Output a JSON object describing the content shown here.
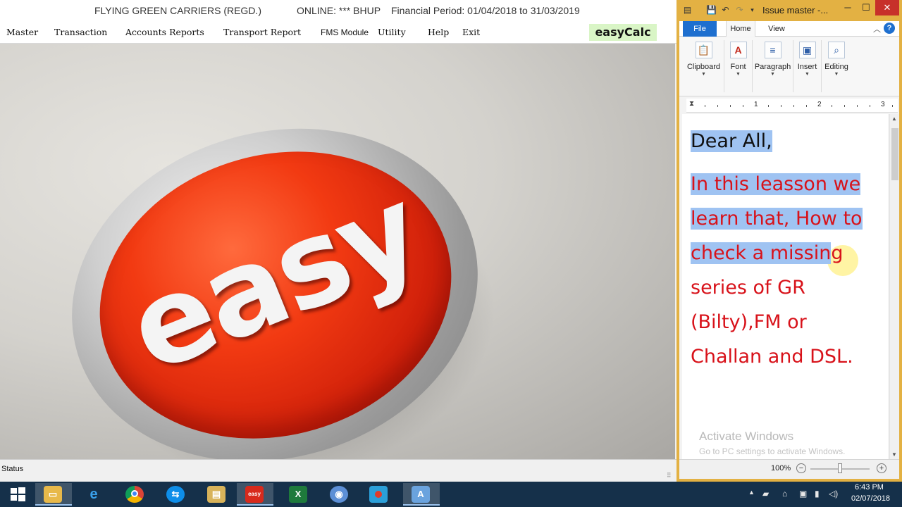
{
  "app": {
    "title_company": "FLYING GREEN CARRIERS (REGD.)",
    "title_online": "ONLINE: *** BHUP",
    "title_period": "Financial Period: 01/04/2018 to 31/03/2019",
    "menu": [
      "Master",
      "Transaction",
      "Accounts Reports",
      "Transport Report",
      "FMS Module",
      "Utility",
      "Help",
      "Exit"
    ],
    "easycalc_label": "easyCalc",
    "hero_text": "easy",
    "status_label": "Status"
  },
  "wordpad": {
    "title": "Issue master -...",
    "tabs": {
      "file": "File",
      "home": "Home",
      "view": "View"
    },
    "ribbon": [
      "Clipboard",
      "Font",
      "Paragraph",
      "Insert",
      "Editing"
    ],
    "ruler_numbers": [
      "1",
      "2",
      "3"
    ],
    "document": {
      "greeting": "Dear All,",
      "line1": "In this leasson we",
      "line2": "learn that, How to",
      "line3_hl": "check a missin",
      "line3_rest": "g",
      "line4": "series of GR",
      "line5": "(Bilty),FM or",
      "line6": "Challan and DSL."
    },
    "watermark_title": "Activate Windows",
    "watermark_sub": "Go to PC settings to activate Windows.",
    "zoom_percent": "100%",
    "zoom_level": 0.5
  },
  "taskbar": {
    "apps": [
      "start-icon",
      "file-explorer-icon",
      "internet-explorer-icon",
      "chrome-icon",
      "teamviewer-icon",
      "folder-icon",
      "easy-app-icon",
      "excel-icon",
      "chrome-alt-icon",
      "recorder-icon",
      "wordpad-icon"
    ],
    "clock_time": "6:43 PM",
    "clock_date": "02/07/2018"
  },
  "colors": {
    "wordpad_frame": "#e3b143",
    "selection": "#9fc3f2",
    "doc_red": "#d8121a",
    "button_red": "#f23a12",
    "easycalc_bg": "#d9f5c6",
    "taskbar": "#15304a"
  }
}
